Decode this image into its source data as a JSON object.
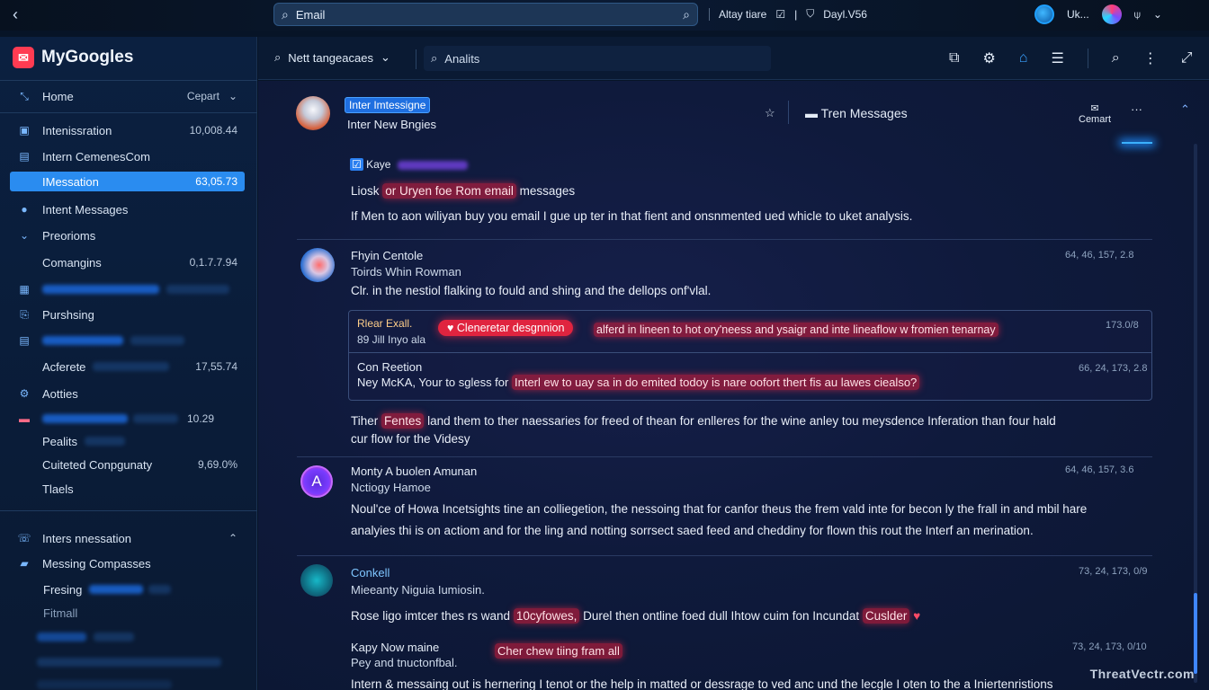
{
  "topbar": {
    "search_value": "Email",
    "alias_label": "Altay tiare",
    "device_label": "Dayl.V56",
    "user_label": "Uk..."
  },
  "sidebar": {
    "brand": "MyGoogles",
    "home": {
      "label": "Home",
      "value": "Cepart"
    },
    "items": [
      {
        "label": "Intenissration",
        "value": "10,008.44"
      },
      {
        "label": "Intern CemenesCom",
        "value": ""
      },
      {
        "label": "IMessation",
        "value": "63,05.73"
      },
      {
        "label": "Intent Messages",
        "value": ""
      },
      {
        "label": "Preorioms",
        "value": ""
      },
      {
        "label": "Comangins",
        "value": "0,1.7.7.94"
      },
      {
        "label": "Purshsing",
        "value": ""
      },
      {
        "label": "Acferete",
        "value": "17,55.74"
      },
      {
        "label": "Aotties",
        "value": ""
      },
      {
        "label": "Pealits",
        "value": "10.29"
      },
      {
        "label": "Cuiteted Conpgunaty",
        "value": "9,69.0%"
      },
      {
        "label": "Tlaels",
        "value": ""
      }
    ],
    "section2": [
      {
        "label": "Inters nnessation"
      },
      {
        "label": "Messing Compasses"
      },
      {
        "label": "Fresing"
      },
      {
        "label": "Fitmall"
      }
    ]
  },
  "toolbar": {
    "dropdown_label": "Nett tangeacaes",
    "analytics_label": "Analits"
  },
  "thread": {
    "badge": "Inter Imtessigne",
    "sender": "Inter New Bngies",
    "tag": "Tren Messages",
    "right_action": "Cemart",
    "pinned_label": "Kaye",
    "line1_pre": "Liosk",
    "line1_hl": "or Uryen foe Rom email",
    "line1_post": "messages",
    "line2": "If Men to aon wiliyan buy you email I gue up ter in that fient and onsnmented ued whicle to uket analysis."
  },
  "messages": [
    {
      "name": "Fhyin Centole",
      "sub": "Toirds Whin Rowman",
      "text": "Clr. in the nestiol flalking to fould and shing and the dellops onf'vlal.",
      "time": "64, 46, 157, 2.8"
    }
  ],
  "cards": [
    {
      "title": "Rlear Exall.",
      "sub": "89 Jill Inyo ala",
      "pill": "♥ Cleneretar desgnnion",
      "text": "alferd in lineen to hot ory'neess and ysaigr and inte lineaflow w fromien tenarnay",
      "time": "173.0/8"
    },
    {
      "title": "Con Reetion",
      "sub_pre": "Ney McKA, Your to sgless for",
      "sub_hl": "Interl ew to uay sa in do emited todoy is nare oofort thert fis au lawes ciealso?",
      "time": "66, 24, 173, 2.8"
    }
  ],
  "after_cards": {
    "pre": "Tiher",
    "hl": "Fentes",
    "post1": "land them to ther naessaries for freed of thean for enlleres for the wine anley tou meysdence Inferation than four hald",
    "post2": "cur flow for the Videsy"
  },
  "message2": {
    "name": "Monty A buolen Amunan",
    "sub": "Nctiogy Hamoe",
    "text1": "Noul'ce of Howa Incetsights tine an colliegetion, the nessoing that for canfor theus the frem vald inte for becon ly the frall in and mbil hare",
    "text2": "analyies thi is on actiom and for the ling and notting sorrsect saed feed and cheddiny for flown this rout the Interf an merination.",
    "time": "64, 46, 157, 3.6",
    "avatar_letter": "A"
  },
  "message3": {
    "name": "Conkell",
    "sub": "Mieeanty Niguia Iumiosin.",
    "text_pre": "Rose ligo imtcer thes rs wand",
    "text_hl": "10cyfowes,",
    "text_post": "Durel then ontline foed dull Ihtow cuim fon Incundat",
    "text_hl2": "Cuslder",
    "time": "73, 24, 173, 0/9"
  },
  "message4": {
    "name": "Kapy Now maine",
    "sub": "Pey and tnuctonfbal.",
    "pill": "Cher chew tiing fram all",
    "text": "Intern & messaing out is hernering I tenot or the help in matted or dessrage to ved anc und the lecgle I oten to the a Iniertenristions",
    "time": "73, 24, 173, 0/10"
  },
  "watermark": "ThreatVectr.com"
}
